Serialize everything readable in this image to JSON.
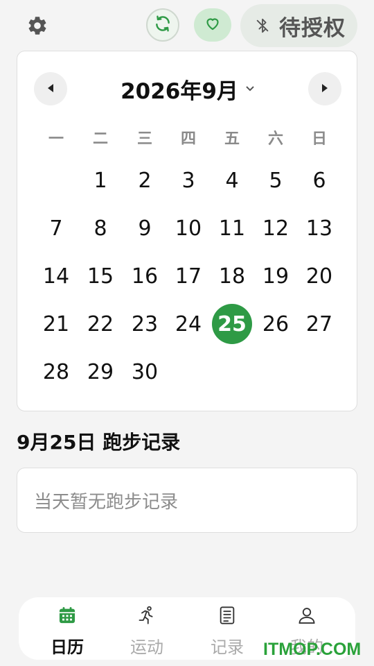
{
  "topbar": {
    "settings_icon": "gear-icon",
    "sync_icon": "refresh-icon",
    "health_icon": "heart-icon",
    "bluetooth_icon": "bluetooth-off-icon",
    "auth_label": "待授权"
  },
  "calendar": {
    "month_label": "2026年9月",
    "weekdays": [
      "一",
      "二",
      "三",
      "四",
      "五",
      "六",
      "日"
    ],
    "days": [
      "1",
      "2",
      "3",
      "4",
      "5",
      "6",
      "7",
      "8",
      "9",
      "10",
      "11",
      "12",
      "13",
      "14",
      "15",
      "16",
      "17",
      "18",
      "19",
      "20",
      "21",
      "22",
      "23",
      "24",
      "25",
      "26",
      "27",
      "28",
      "29",
      "30"
    ],
    "first_weekday_index": 1,
    "selected_day": "25",
    "accent_color": "#2e9a45"
  },
  "record": {
    "title": "9月25日 跑步记录",
    "empty_text": "当天暂无跑步记录"
  },
  "bottom_nav": {
    "tabs": [
      {
        "label": "日历",
        "icon": "calendar-icon",
        "active": true
      },
      {
        "label": "运动",
        "icon": "running-icon",
        "active": false
      },
      {
        "label": "记录",
        "icon": "document-icon",
        "active": false
      },
      {
        "label": "我的",
        "icon": "user-icon",
        "active": false
      }
    ]
  },
  "watermark": "ITMOP.COM"
}
